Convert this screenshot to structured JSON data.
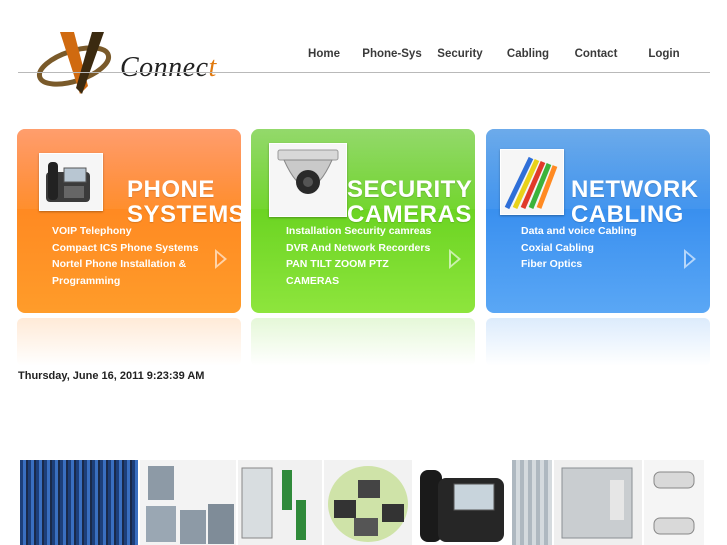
{
  "logo": {
    "brand_main": "Connec",
    "brand_accent": "t"
  },
  "nav": [
    {
      "label": "Home"
    },
    {
      "label": "Phone-Sys"
    },
    {
      "label": "Security"
    },
    {
      "label": "Cabling"
    },
    {
      "label": "Contact"
    },
    {
      "label": "Login"
    }
  ],
  "cards": {
    "phone": {
      "title": "PHONE\nSYSTEMS",
      "items": [
        "VOIP Telephony",
        "Compact ICS Phone Systems",
        "Nortel Phone Installation & Programming"
      ]
    },
    "security": {
      "title": "SECURITY\nCAMERAS",
      "items": [
        "Installation Security camreas",
        "DVR And Network Recorders",
        "PAN TILT ZOOM PTZ CAMERAS"
      ]
    },
    "network": {
      "title": "NETWORK\nCABLING",
      "items": [
        "Data and voice Cabling",
        "Coxial Cabling",
        "Fiber Optics"
      ]
    }
  },
  "datetime": "Thursday, June 16, 2011 9:23:39 AM",
  "colors": {
    "phone": "#ff7a20",
    "security": "#6fd625",
    "network": "#3d92f0",
    "accent": "#e07a10"
  }
}
